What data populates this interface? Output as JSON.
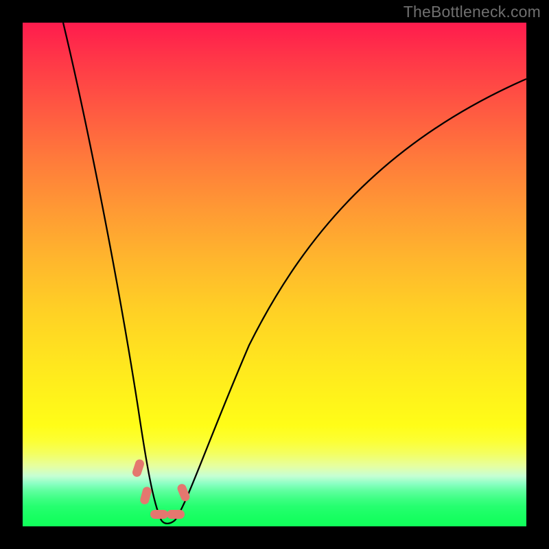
{
  "watermark": "TheBottleneck.com",
  "chart_data": {
    "type": "line",
    "title": "",
    "xlabel": "",
    "ylabel": "",
    "xlim": [
      0,
      100
    ],
    "ylim": [
      0,
      100
    ],
    "grid": false,
    "legend": false,
    "note": "No axis ticks or numeric labels are rendered in the image; values are proportional estimates read from geometry.",
    "series": [
      {
        "name": "bottleneck-curve",
        "x": [
          8,
          12,
          16,
          20,
          23,
          25,
          26.5,
          28,
          30,
          32,
          34,
          38,
          44,
          52,
          62,
          74,
          88,
          100
        ],
        "y": [
          100,
          75,
          52,
          32,
          16,
          6,
          2,
          2,
          4,
          8,
          14,
          26,
          40,
          54,
          66,
          76,
          84,
          89
        ]
      }
    ],
    "markers": [
      {
        "x": 22.5,
        "y": 12,
        "color": "#e4776f"
      },
      {
        "x": 24.2,
        "y": 5.5,
        "color": "#e4776f"
      },
      {
        "x": 26.0,
        "y": 1.5,
        "color": "#e4776f"
      },
      {
        "x": 29.0,
        "y": 1.5,
        "color": "#e4776f"
      },
      {
        "x": 31.5,
        "y": 6.8,
        "color": "#e4776f"
      }
    ],
    "gradient_stops": [
      {
        "pos": 0.0,
        "color": "#ff1b4d"
      },
      {
        "pos": 0.5,
        "color": "#ffc726"
      },
      {
        "pos": 0.8,
        "color": "#fffd18"
      },
      {
        "pos": 1.0,
        "color": "#10ff5a"
      }
    ]
  }
}
